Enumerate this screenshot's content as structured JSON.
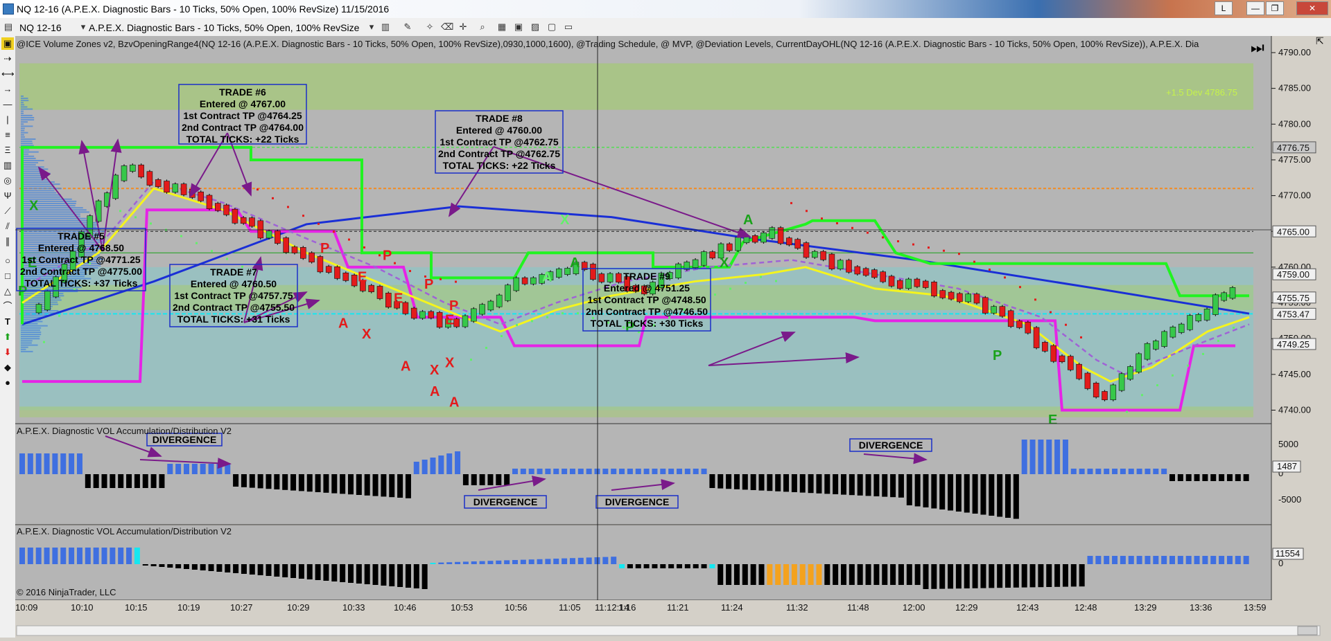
{
  "window": {
    "title": "NQ 12-16 (A.P.E.X. Diagnostic Bars - 10 Ticks, 50% Open, 100% RevSize)  11/15/2016",
    "buttons": [
      "L",
      "—",
      "❐",
      "✕"
    ]
  },
  "toolbar": {
    "instrument": "NQ 12-16",
    "bar_type": "A.P.E.X. Diagnostic Bars - 10 Ticks, 50% Open, 100% RevSize"
  },
  "indicator_line": "@ICE Volume Zones v2, BzvOpeningRange4(NQ 12-16 (A.P.E.X. Diagnostic Bars - 10 Ticks, 50% Open, 100% RevSize),0930,1000,1600), @Trading Schedule, @ MVP, @Deviation Levels, CurrentDayOHL(NQ 12-16 (A.P.E.X. Diagnostic Bars - 10 Ticks, 50% Open, 100% RevSize)), A.P.E.X. Dia",
  "zone_label": "+1.5 Dev 4786.75",
  "price_axis": {
    "ticks": [
      "4790.00",
      "4785.00",
      "4780.00",
      "4775.00",
      "4770.00",
      "4765.00",
      "4760.00",
      "4755.00",
      "4750.00",
      "4745.00",
      "4740.00"
    ],
    "highlight": [
      "4776.75",
      "4765.00",
      "4759.00",
      "4755.75",
      "4753.47",
      "4749.25"
    ]
  },
  "osc1": {
    "title": "A.P.E.X. Diagnostic VOL Accumulation/Distribution V2",
    "ticks": [
      "5000",
      "0",
      "-5000"
    ],
    "current": "1487"
  },
  "osc2": {
    "title": "A.P.E.X. Diagnostic VOL Accumulation/Distribution V2",
    "ticks": [
      "0"
    ],
    "current": "11554"
  },
  "copyright": "© 2016 NinjaTrader, LLC",
  "time_axis": [
    "10:09",
    "10:10",
    "10:15",
    "10:19",
    "10:27",
    "10:29",
    "10:33",
    "10:46",
    "10:53",
    "10:56",
    "11:05",
    "11:12:14",
    "1:16",
    "11:21",
    "11:24",
    "11:32",
    "11:48",
    "12:00",
    "12:29",
    "12:43",
    "12:48",
    "13:29",
    "13:36",
    "13:59"
  ],
  "trades": [
    {
      "id": "t5",
      "lines": [
        "TRADE #5",
        "Entered @ 4768.50",
        "1st Contract TP @4771.25",
        "2nd Contract TP @4775.00",
        "TOTAL TICKS: +37 Ticks"
      ]
    },
    {
      "id": "t6",
      "lines": [
        "TRADE #6",
        "Entered @ 4767.00",
        "1st Contract TP @4764.25",
        "2nd Contract TP @4764.00",
        "TOTAL TICKS: +22 Ticks"
      ]
    },
    {
      "id": "t7",
      "lines": [
        "TRADE #7",
        "Entered @ 4760.50",
        "1st Contract TP @4757.75",
        "2nd Contract TP @4755.50",
        "TOTAL TICKS: +31 Ticks"
      ]
    },
    {
      "id": "t8",
      "lines": [
        "TRADE #8",
        "Entered @ 4760.00",
        "1st Contract TP @4762.75",
        "2nd Contract TP @4762.75",
        "TOTAL TICKS: +22 Ticks"
      ]
    },
    {
      "id": "t9",
      "lines": [
        "TRADE #9",
        "Entered @ 4751.25",
        "1st Contract TP @4748.50",
        "2nd Contract TP @4746.50",
        "TOTAL TICKS: +30 Ticks"
      ]
    }
  ],
  "divergence_label": "DIVERGENCE",
  "marks": {
    "x": "X",
    "a": "A",
    "p": "P",
    "e": "E"
  },
  "colors": {
    "chart_bg": "#b5b5b5",
    "zone_green": "#a6c97a",
    "zone_teal": "#8fc4c4",
    "up_bar": "#37c84a",
    "down_bar": "#e31b1b",
    "ema_blue": "#1a2fd6",
    "lime_line": "#21f321",
    "magenta_line": "#e623e6",
    "yellow_line": "#f4f41e",
    "osc_blue": "#3f6fe0",
    "osc_cyan": "#16e7f0",
    "osc_orange": "#f4a21e"
  }
}
